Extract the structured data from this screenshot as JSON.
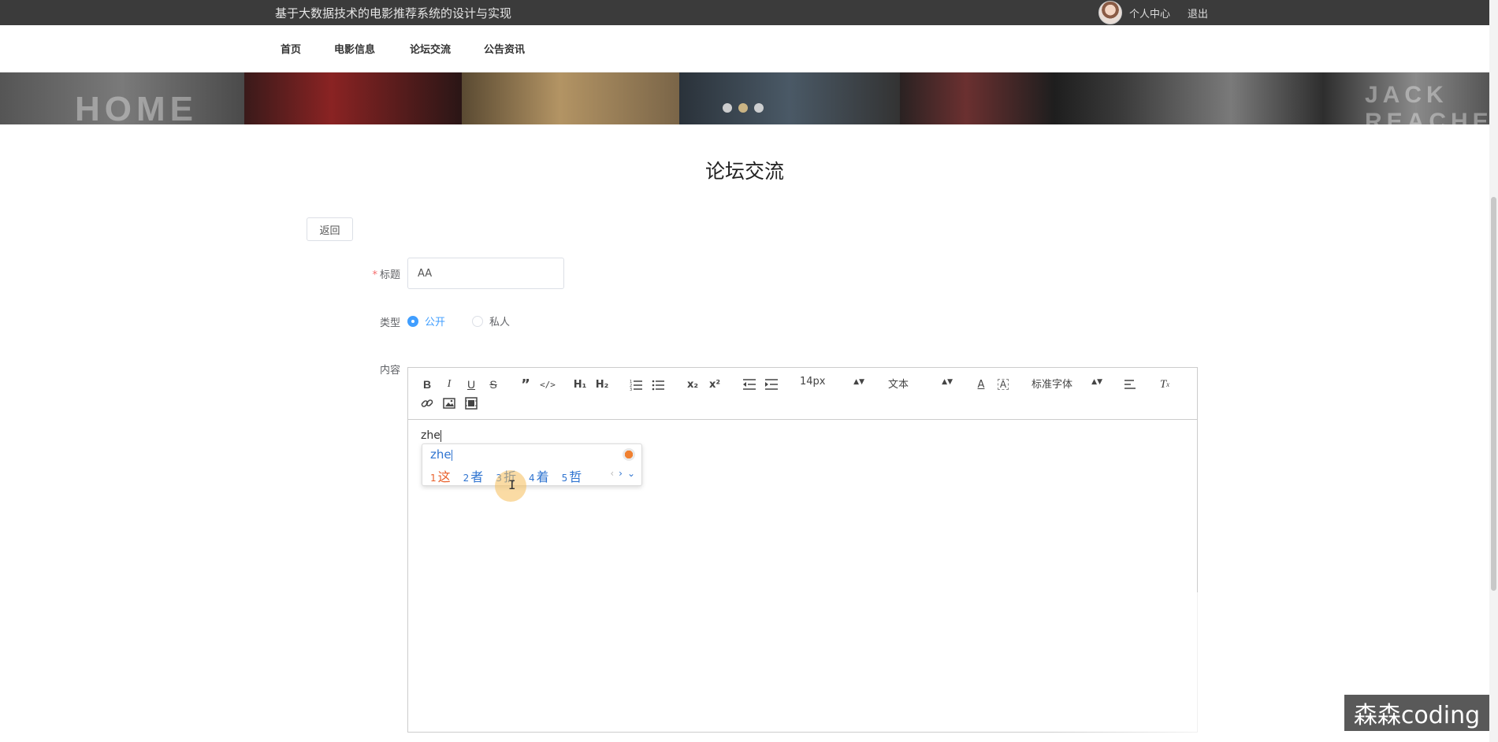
{
  "header": {
    "site_title": "基于大数据技术的电影推荐系统的设计与实现",
    "personal_center": "个人中心",
    "logout": "退出"
  },
  "nav": {
    "items": [
      {
        "label": "首页"
      },
      {
        "label": "电影信息"
      },
      {
        "label": "论坛交流"
      },
      {
        "label": "公告资讯"
      }
    ]
  },
  "banner": {
    "panel_texts": [
      "HOME",
      "JACK REACHER"
    ],
    "active_dot": 1
  },
  "page": {
    "title": "论坛交流",
    "back_button": "返回"
  },
  "form": {
    "title_label": "标题",
    "title_value": "AA",
    "type_label": "类型",
    "type_options": [
      "公开",
      "私人"
    ],
    "type_selected": "公开",
    "content_label": "内容"
  },
  "editor": {
    "font_size": "14px",
    "header_style": "文本",
    "font_family": "标准字体",
    "content_text": "zhe"
  },
  "ime": {
    "composition": "zhe",
    "candidates": [
      {
        "num": "1",
        "char": "这"
      },
      {
        "num": "2",
        "char": "者"
      },
      {
        "num": "3",
        "char": "折"
      },
      {
        "num": "4",
        "char": "着"
      },
      {
        "num": "5",
        "char": "哲"
      }
    ]
  },
  "watermark": "森森coding",
  "colors": {
    "topbar": "#3b3b3b",
    "primary": "#409eff",
    "required": "#f56c6c",
    "ime_blue": "#2f74d0",
    "ime_first": "#e9602b"
  }
}
